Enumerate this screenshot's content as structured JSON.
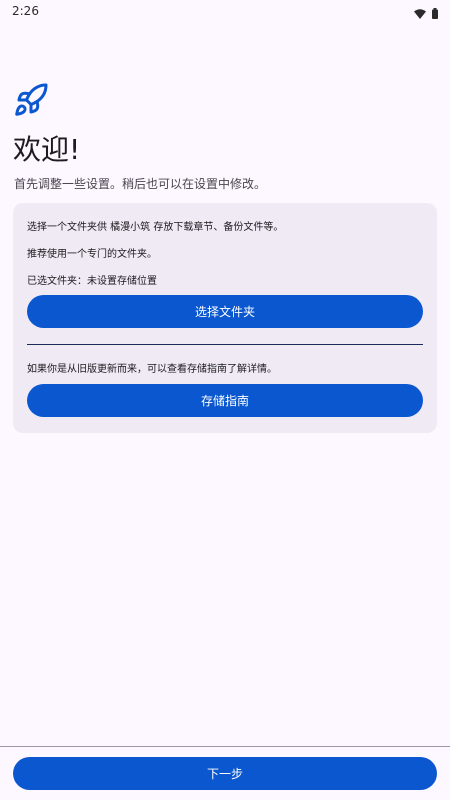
{
  "status_bar": {
    "time": "2:26",
    "icons": [
      "wifi-icon",
      "battery-icon"
    ]
  },
  "header": {
    "icon": "rocket-icon",
    "title": "欢迎!",
    "subtitle": "首先调整一些设置。稍后也可以在设置中修改。"
  },
  "folder_card": {
    "description": "选择一个文件夹供 橘漫小筑 存放下载章节、备份文件等。",
    "recommendation": "推荐使用一个专门的文件夹。",
    "selected_folder": "已选文件夹：未设置存储位置",
    "select_button_label": "选择文件夹",
    "upgrade_note": "如果你是从旧版更新而来，可以查看存储指南了解详情。",
    "guide_button_label": "存储指南"
  },
  "footer": {
    "next_button_label": "下一步"
  },
  "colors": {
    "background": "#fdf7ff",
    "card_background": "#efeaf4",
    "primary": "#0b57d0",
    "on_primary": "#ffffff"
  }
}
